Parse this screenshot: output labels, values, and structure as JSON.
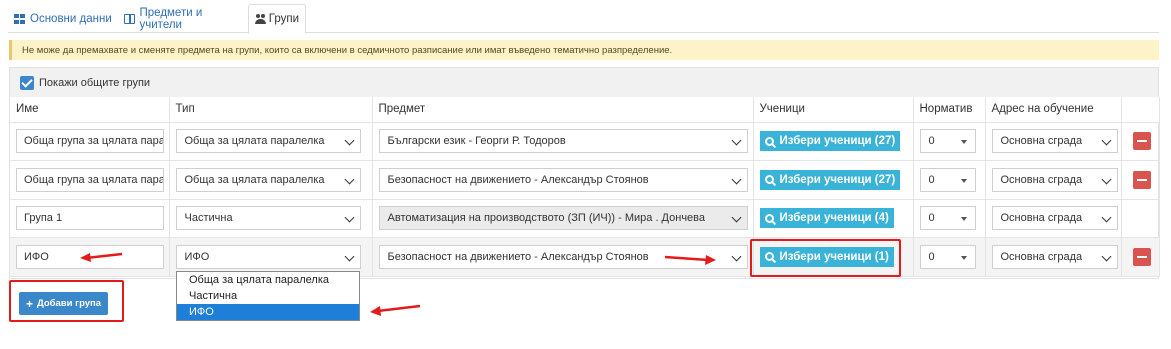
{
  "tabs": [
    {
      "label": "Основни данни",
      "icon": "grid-icon"
    },
    {
      "label": "Предмети и учители",
      "icon": "book-icon"
    },
    {
      "label": "Групи",
      "icon": "users-icon",
      "active": true
    }
  ],
  "alert": "Не може да премахвате и сменяте предмета на групи, които са включени в седмичното разписание или имат въведено тематично разпределение.",
  "show_common": {
    "label": "Покажи общите групи",
    "checked": true
  },
  "columns": [
    "Име",
    "Тип",
    "Предмет",
    "Ученици",
    "Норматив",
    "Адрес на обучение"
  ],
  "rows": [
    {
      "name": "Обща група за цялата паралелка",
      "type": "Обща за цялата паралелка",
      "subject": "Български език - Георги Р. Тодоров",
      "students": "Избери ученици (27)",
      "norm": "0",
      "address": "Основна сграда",
      "removable": true
    },
    {
      "name": "Обща група за цялата паралелка",
      "type": "Обща за цялата паралелка",
      "subject": "Безопасност на движението - Александър Стоянов",
      "students": "Избери ученици (27)",
      "norm": "0",
      "address": "Основна сграда",
      "removable": true
    },
    {
      "name": "Група 1",
      "type": "Частична",
      "subject": "Автоматизация на производството (ЗП (ИЧ)) - Мира . Дончева",
      "students": "Избери ученици (4)",
      "norm": "0",
      "address": "Основна сграда",
      "removable": false
    },
    {
      "name": "ИФО",
      "type": "ИФО",
      "subject": "Безопасност на движението - Александър Стоянов",
      "students": "Избери ученици (1)",
      "norm": "0",
      "address": "Основна сграда",
      "removable": true
    }
  ],
  "type_options": [
    "Обща за цялата паралелка",
    "Частична",
    "ИФО"
  ],
  "type_selected": "ИФО",
  "add_button": "Добави група",
  "colors": {
    "accent": "#3a87c9",
    "info": "#39b3d7",
    "danger": "#d9534f",
    "highlight": "#e31b1b",
    "alert_bg": "#fcf3c9"
  }
}
